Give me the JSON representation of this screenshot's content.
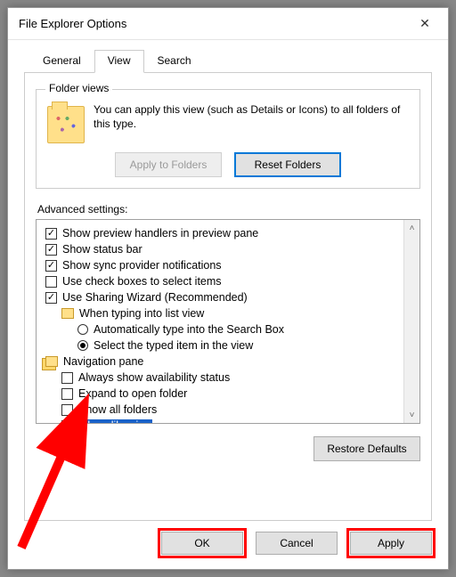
{
  "window": {
    "title": "File Explorer Options"
  },
  "tabs": {
    "general": "General",
    "view": "View",
    "search": "Search"
  },
  "folder_views": {
    "legend": "Folder views",
    "desc": "You can apply this view (such as Details or Icons) to all folders of this type.",
    "apply": "Apply to Folders",
    "reset": "Reset Folders"
  },
  "advanced": {
    "label": "Advanced settings:",
    "items": [
      {
        "kind": "check",
        "checked": true,
        "label": "Show preview handlers in preview pane"
      },
      {
        "kind": "check",
        "checked": true,
        "label": "Show status bar"
      },
      {
        "kind": "check",
        "checked": true,
        "label": "Show sync provider notifications"
      },
      {
        "kind": "check",
        "checked": false,
        "label": "Use check boxes to select items"
      },
      {
        "kind": "check",
        "checked": true,
        "label": "Use Sharing Wizard (Recommended)"
      },
      {
        "kind": "group",
        "icon": "folder",
        "label": "When typing into list view"
      },
      {
        "kind": "radio",
        "selected": false,
        "label": "Automatically type into the Search Box"
      },
      {
        "kind": "radio",
        "selected": true,
        "label": "Select the typed item in the view"
      },
      {
        "kind": "group",
        "icon": "folder-stack",
        "label": "Navigation pane"
      },
      {
        "kind": "check",
        "checked": false,
        "label": "Always show availability status"
      },
      {
        "kind": "check",
        "checked": false,
        "label": "Expand to open folder"
      },
      {
        "kind": "check",
        "checked": false,
        "label": "Show all folders"
      },
      {
        "kind": "check",
        "checked": true,
        "label": "Show libraries",
        "selected_row": true
      }
    ],
    "restore": "Restore Defaults"
  },
  "buttons": {
    "ok": "OK",
    "cancel": "Cancel",
    "apply": "Apply"
  }
}
